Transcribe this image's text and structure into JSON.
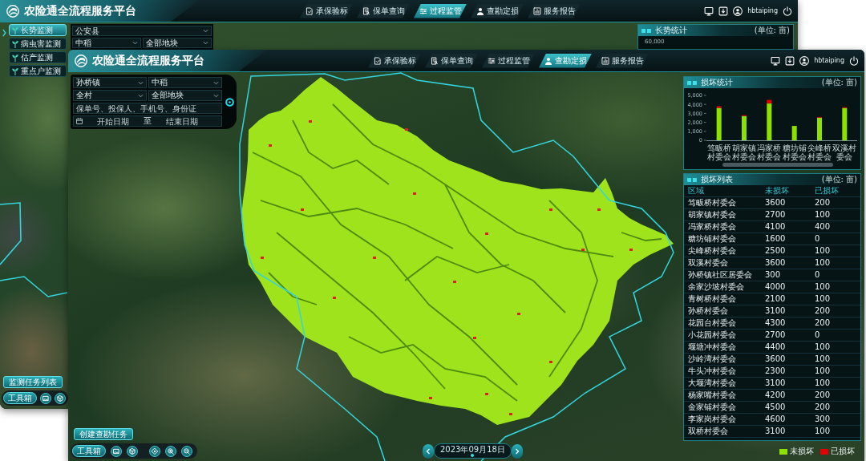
{
  "back_window": {
    "header": {
      "title": "农险通全流程服务平台",
      "tabs": [
        {
          "label": "承保验标",
          "selected": false
        },
        {
          "label": "保单查询",
          "selected": false
        },
        {
          "label": "过程监管",
          "selected": true
        },
        {
          "label": "查勘定损",
          "selected": false
        },
        {
          "label": "服务报告",
          "selected": false
        }
      ],
      "user": "hbtaiping"
    },
    "sidebar": {
      "items": [
        {
          "label": "长势监测",
          "selected": true
        },
        {
          "label": "病虫害监测",
          "selected": false
        },
        {
          "label": "估产监测",
          "selected": false
        },
        {
          "label": "重点户监测",
          "selected": false
        }
      ]
    },
    "filters": {
      "county": "公安县",
      "crop": "中稻",
      "plot": "全部地块"
    },
    "stats_panel": {
      "title": "长势统计",
      "unit": "(单位: 亩)",
      "axis_label": "60,000"
    },
    "task_list_button": "监测任务列表",
    "toolbox": "工具箱"
  },
  "front_window": {
    "header": {
      "title": "农险通全流程服务平台",
      "tabs": [
        {
          "label": "承保验标",
          "selected": false
        },
        {
          "label": "保单查询",
          "selected": false
        },
        {
          "label": "过程监管",
          "selected": false
        },
        {
          "label": "查勘定损",
          "selected": true
        },
        {
          "label": "服务报告",
          "selected": false
        }
      ],
      "user": "hbtaiping"
    },
    "filters": {
      "town": "孙桥镇",
      "crop": "中稻",
      "village": "全村",
      "plot": "全部地块",
      "search": {
        "placeholder": "保单号、投保人、手机号、身份证"
      },
      "date_range": {
        "start": {
          "placeholder": "开始日期"
        },
        "separator": "至",
        "end": {
          "placeholder": "结束日期"
        }
      }
    },
    "stats_panel": {
      "title": "损坏统计",
      "unit": "(单位: 亩)",
      "chart_data": {
        "type": "bar",
        "stacked": true,
        "categories": [
          "笃畈桥村委会",
          "胡家镇村委会",
          "冯家桥村委会",
          "糖坊铺村委会",
          "尖峰桥村委会",
          "双溪村委会"
        ],
        "series": [
          {
            "color": "#8ee000",
            "values": [
              3600,
              2700,
              4100,
              1600,
              2500,
              3600
            ]
          },
          {
            "color": "#e50000",
            "values": [
              200,
              100,
              400,
              0,
              100,
              100
            ]
          }
        ],
        "ylim": [
          0,
          5000
        ],
        "yticks": [
          0,
          {
            "value": 1000,
            "label": "1,000"
          },
          {
            "value": 2000,
            "label": "2,000"
          },
          {
            "value": 3000,
            "label": "3,000"
          },
          {
            "value": 4000,
            "label": "4,000"
          },
          {
            "value": 5000,
            "label": "5,000"
          }
        ]
      }
    },
    "list_panel": {
      "title": "损坏列表",
      "unit": "(单位: 亩)",
      "table": {
        "columns": [
          "区域",
          "未损坏",
          "已损坏"
        ],
        "rows": [
          [
            "笃畈桥村委会",
            "3600",
            "200"
          ],
          [
            "胡家镇村委会",
            "2700",
            "100"
          ],
          [
            "冯家桥村委会",
            "4100",
            "400"
          ],
          [
            "糖坊铺村委会",
            "1600",
            "0"
          ],
          [
            "尖峰桥村委会",
            "2500",
            "100"
          ],
          [
            "双溪村委会",
            "3600",
            "100"
          ],
          [
            "孙桥镇社区居委会",
            "300",
            "0"
          ],
          [
            "余家沙坡村委会",
            "4000",
            "100"
          ],
          [
            "青树桥村委会",
            "2100",
            "100"
          ],
          [
            "孙桥村委会",
            "3100",
            "200"
          ],
          [
            "花园台村委会",
            "4300",
            "200"
          ],
          [
            "小花园村委会",
            "2700",
            "0"
          ],
          [
            "堰塘冲村委会",
            "4400",
            "100"
          ],
          [
            "沙岭湾村委会",
            "3600",
            "100"
          ],
          [
            "牛头冲村委会",
            "2300",
            "100"
          ],
          [
            "大堰湾村委会",
            "3100",
            "100"
          ],
          [
            "杨家嘴村委会",
            "4200",
            "200"
          ],
          [
            "金家铺村委会",
            "4500",
            "200"
          ],
          [
            "李家岗村委会",
            "4600",
            "300"
          ],
          [
            "双桥村委会",
            "3100",
            "100"
          ]
        ]
      }
    },
    "map_legend": [
      {
        "label": "未损坏",
        "color": "#8ee000"
      },
      {
        "label": "已损坏",
        "color": "#e50000"
      }
    ],
    "task_button": "创建查勘任务",
    "toolbox": "工具箱",
    "date_nav": {
      "date": "2023年09月18日"
    }
  }
}
